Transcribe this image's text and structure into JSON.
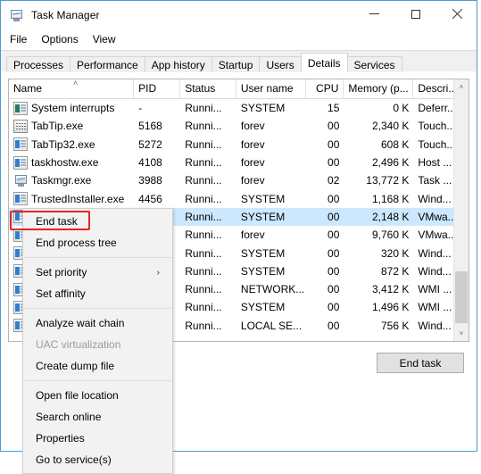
{
  "window": {
    "title": "Task Manager",
    "icon": "task-manager-monitor-icon",
    "accent_color": "#4a9ad4",
    "controls": {
      "minimize": "—",
      "maximize": "□",
      "close": "✕"
    }
  },
  "menubar": {
    "items": [
      {
        "label": "File"
      },
      {
        "label": "Options"
      },
      {
        "label": "View"
      }
    ]
  },
  "tabs": {
    "items": [
      {
        "label": "Processes",
        "active": false
      },
      {
        "label": "Performance",
        "active": false
      },
      {
        "label": "App history",
        "active": false
      },
      {
        "label": "Startup",
        "active": false
      },
      {
        "label": "Users",
        "active": false
      },
      {
        "label": "Details",
        "active": true
      },
      {
        "label": "Services",
        "active": false
      }
    ]
  },
  "table": {
    "sort_indicator": "˄",
    "sort_column": "Name",
    "sort_direction": "ascending",
    "columns": [
      {
        "key": "name",
        "label": "Name"
      },
      {
        "key": "pid",
        "label": "PID"
      },
      {
        "key": "status",
        "label": "Status"
      },
      {
        "key": "user",
        "label": "User name"
      },
      {
        "key": "cpu",
        "label": "CPU"
      },
      {
        "key": "memory",
        "label": "Memory (p..."
      },
      {
        "key": "desc",
        "label": "Descri..."
      }
    ],
    "rows": [
      {
        "icon": "system-process-icon",
        "name": "System interrupts",
        "pid": "-",
        "status": "Runni...",
        "user": "SYSTEM",
        "cpu": "15",
        "memory": "0 K",
        "desc": "Deferr...",
        "selected": false,
        "obscured": false
      },
      {
        "icon": "keyboard-icon",
        "name": "TabTip.exe",
        "pid": "5168",
        "status": "Runni...",
        "user": "forev",
        "cpu": "00",
        "memory": "2,340 K",
        "desc": "Touch...",
        "selected": false,
        "obscured": false
      },
      {
        "icon": "app-icon",
        "name": "TabTip32.exe",
        "pid": "5272",
        "status": "Runni...",
        "user": "forev",
        "cpu": "00",
        "memory": "608 K",
        "desc": "Touch...",
        "selected": false,
        "obscured": false
      },
      {
        "icon": "app-icon",
        "name": "taskhostw.exe",
        "pid": "4108",
        "status": "Runni...",
        "user": "forev",
        "cpu": "00",
        "memory": "2,496 K",
        "desc": "Host ...",
        "selected": false,
        "obscured": false
      },
      {
        "icon": "task-manager-monitor-icon",
        "name": "Taskmgr.exe",
        "pid": "3988",
        "status": "Runni...",
        "user": "forev",
        "cpu": "02",
        "memory": "13,772 K",
        "desc": "Task ...",
        "selected": false,
        "obscured": false
      },
      {
        "icon": "app-icon",
        "name": "TrustedInstaller.exe",
        "pid": "4456",
        "status": "Runni...",
        "user": "SYSTEM",
        "cpu": "00",
        "memory": "1,168 K",
        "desc": "Wind...",
        "selected": false,
        "obscured": false
      },
      {
        "icon": "app-icon",
        "name": "",
        "pid": "",
        "status": "Runni...",
        "user": "SYSTEM",
        "cpu": "00",
        "memory": "2,148 K",
        "desc": "VMwa...",
        "selected": true,
        "obscured": true
      },
      {
        "icon": "app-icon",
        "name": "",
        "pid": "",
        "status": "Runni...",
        "user": "forev",
        "cpu": "00",
        "memory": "9,760 K",
        "desc": "VMwa...",
        "selected": false,
        "obscured": true
      },
      {
        "icon": "app-icon",
        "name": "",
        "pid": "",
        "status": "Runni...",
        "user": "SYSTEM",
        "cpu": "00",
        "memory": "320 K",
        "desc": "Wind...",
        "selected": false,
        "obscured": true
      },
      {
        "icon": "app-icon",
        "name": "",
        "pid": "",
        "status": "Runni...",
        "user": "SYSTEM",
        "cpu": "00",
        "memory": "872 K",
        "desc": "Wind...",
        "selected": false,
        "obscured": true
      },
      {
        "icon": "app-icon",
        "name": "",
        "pid": "",
        "status": "Runni...",
        "user": "NETWORK...",
        "cpu": "00",
        "memory": "3,412 K",
        "desc": "WMI ...",
        "selected": false,
        "obscured": true
      },
      {
        "icon": "app-icon",
        "name": "",
        "pid": "",
        "status": "Runni...",
        "user": "SYSTEM",
        "cpu": "00",
        "memory": "1,496 K",
        "desc": "WMI ...",
        "selected": false,
        "obscured": true
      },
      {
        "icon": "app-icon",
        "name": "",
        "pid": "",
        "status": "Runni...",
        "user": "LOCAL SE...",
        "cpu": "00",
        "memory": "756 K",
        "desc": "Wind...",
        "selected": false,
        "obscured": true
      }
    ],
    "scrollbar": {
      "up_arrow": "˄",
      "down_arrow": "˅"
    }
  },
  "footer": {
    "end_task_button": "End task"
  },
  "context_menu": {
    "highlight_color": "#e8231f",
    "highlighted_item": "End task",
    "items": [
      {
        "label": "End task",
        "disabled": false,
        "submenu": false,
        "separator_after": false,
        "highlighted": true
      },
      {
        "label": "End process tree",
        "disabled": false,
        "submenu": false,
        "separator_after": true,
        "highlighted": false
      },
      {
        "label": "Set priority",
        "disabled": false,
        "submenu": true,
        "separator_after": false,
        "highlighted": false,
        "submenu_arrow": "›"
      },
      {
        "label": "Set affinity",
        "disabled": false,
        "submenu": false,
        "separator_after": true,
        "highlighted": false
      },
      {
        "label": "Analyze wait chain",
        "disabled": false,
        "submenu": false,
        "separator_after": false,
        "highlighted": false
      },
      {
        "label": "UAC virtualization",
        "disabled": true,
        "submenu": false,
        "separator_after": false,
        "highlighted": false
      },
      {
        "label": "Create dump file",
        "disabled": false,
        "submenu": false,
        "separator_after": true,
        "highlighted": false
      },
      {
        "label": "Open file location",
        "disabled": false,
        "submenu": false,
        "separator_after": false,
        "highlighted": false
      },
      {
        "label": "Search online",
        "disabled": false,
        "submenu": false,
        "separator_after": false,
        "highlighted": false
      },
      {
        "label": "Properties",
        "disabled": false,
        "submenu": false,
        "separator_after": false,
        "highlighted": false
      },
      {
        "label": "Go to service(s)",
        "disabled": false,
        "submenu": false,
        "separator_after": false,
        "highlighted": false
      }
    ]
  }
}
